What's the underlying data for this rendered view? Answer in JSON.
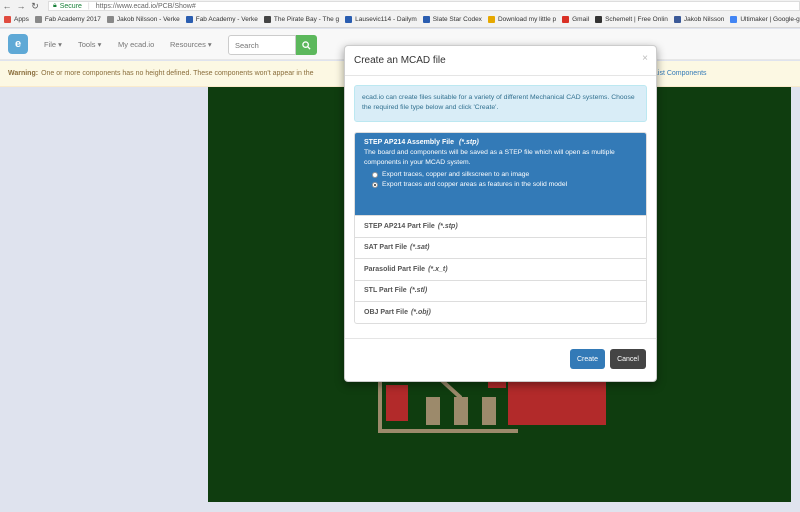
{
  "browser": {
    "secure_label": "Secure",
    "url": "https://www.ecad.io/PCB/Show#",
    "bookmarks": [
      {
        "label": "Apps",
        "color": "#e04b3f"
      },
      {
        "label": "Fab Academy 2017",
        "color": "#888888"
      },
      {
        "label": "Jakob Nilsson - Verke",
        "color": "#888888"
      },
      {
        "label": "Fab Academy - Verke",
        "color": "#2a5db0"
      },
      {
        "label": "The Pirate Bay - The g",
        "color": "#444444"
      },
      {
        "label": "Lausevic114 - Dailym",
        "color": "#2a5db0"
      },
      {
        "label": "Slate Star Codex",
        "color": "#2a5db0"
      },
      {
        "label": "Download my little p",
        "color": "#e6a800"
      },
      {
        "label": "Gmail",
        "color": "#d93025"
      },
      {
        "label": "Schemelt | Free Onlin",
        "color": "#333333"
      },
      {
        "label": "Jakob Nilsson",
        "color": "#3b5998"
      },
      {
        "label": "Ultimaker | Google-g",
        "color": "#4285f4"
      }
    ]
  },
  "navbar": {
    "logo_text": "e",
    "items": [
      "File ▾",
      "Tools ▾",
      "My ecad.io",
      "Resources ▾"
    ],
    "search_placeholder": "Search"
  },
  "warning": {
    "label": "Warning:",
    "text": "One or more components has no height defined. These components won't appear in the",
    "link": "List Components"
  },
  "modal": {
    "title": "Create an MCAD file",
    "close": "×",
    "info": "ecad.io can create files suitable for a variety of different Mechanical CAD systems. Choose the required file type below and click 'Create'.",
    "active_option": {
      "title": "STEP AP214 Assembly File",
      "ext": "(*.stp)",
      "desc": "The board and components will be saved as a STEP file which will open as multiple components in your MCAD system.",
      "radios": [
        {
          "label": "Export traces, copper and silkscreen to an image",
          "checked": false
        },
        {
          "label": "Export traces and copper areas as features in the solid model",
          "checked": true
        }
      ]
    },
    "options": [
      {
        "name": "STEP AP214 Part File",
        "ext": "(*.stp)"
      },
      {
        "name": "SAT Part File",
        "ext": "(*.sat)"
      },
      {
        "name": "Parasolid Part File",
        "ext": "(*.x_t)"
      },
      {
        "name": "STL Part File",
        "ext": "(*.stl)"
      },
      {
        "name": "OBJ Part File",
        "ext": "(*.obj)"
      }
    ],
    "create_label": "Create",
    "cancel_label": "Cancel"
  }
}
